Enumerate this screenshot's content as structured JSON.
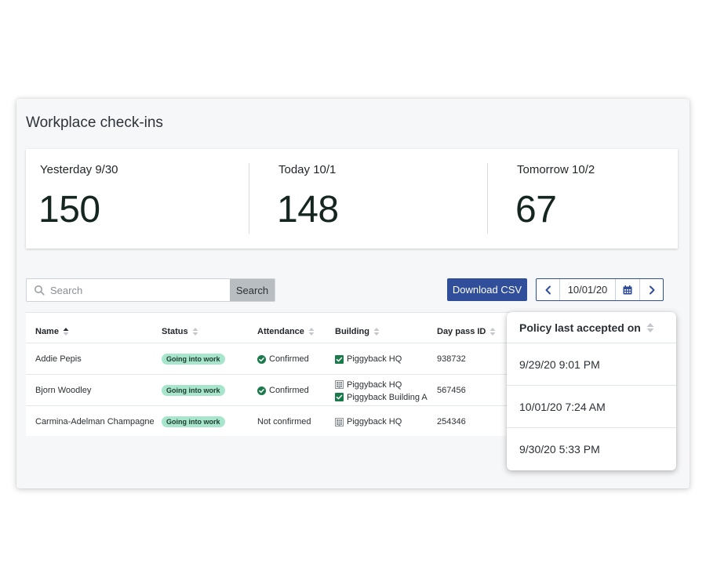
{
  "page": {
    "title": "Workplace check-ins"
  },
  "stats": [
    {
      "label": "Yesterday 9/30",
      "value": "150"
    },
    {
      "label": "Today 10/1",
      "value": "148"
    },
    {
      "label": "Tomorrow 10/2",
      "value": "67"
    }
  ],
  "search": {
    "placeholder": "Search",
    "value": "",
    "button_label": "Search",
    "icon": "search-icon"
  },
  "toolbar": {
    "download_label": "Download CSV"
  },
  "date_picker": {
    "value": "10/01/20",
    "prev_icon": "chevron-left-icon",
    "calendar_icon": "calendar-icon",
    "next_icon": "chevron-right-icon"
  },
  "table": {
    "columns": [
      "Name",
      "Status",
      "Attendance",
      "Building",
      "Day pass ID"
    ],
    "sorted_column": "Name",
    "rows": [
      {
        "name": "Addie Pepis",
        "status": "Going into work",
        "attendance": "Confirmed",
        "attendance_confirmed": true,
        "buildings": [
          {
            "name": "Piggyback HQ",
            "icon": "check-square-icon"
          }
        ],
        "day_pass_id": "938732"
      },
      {
        "name": "Bjorn Woodley",
        "status": "Going into work",
        "attendance": "Confirmed",
        "attendance_confirmed": true,
        "buildings": [
          {
            "name": "Piggyback HQ",
            "icon": "building-icon"
          },
          {
            "name": "Piggyback Building A",
            "icon": "check-square-icon"
          }
        ],
        "day_pass_id": "567456"
      },
      {
        "name": "Carmina-Adelman Champagne",
        "status": "Going into work",
        "attendance": "Not confirmed",
        "attendance_confirmed": false,
        "buildings": [
          {
            "name": "Piggyback HQ",
            "icon": "building-icon"
          }
        ],
        "day_pass_id": "254346"
      }
    ]
  },
  "policy_column": {
    "header": "Policy last accepted on",
    "values": [
      "9/29/20 9:01 PM",
      "10/01/20 7:24 AM",
      "9/30/20 5:33 PM"
    ]
  },
  "colors": {
    "primary": "#304e9a",
    "badge": "#a8e5cd",
    "success": "#1a7a4c",
    "panel": "#f6f7f9"
  }
}
